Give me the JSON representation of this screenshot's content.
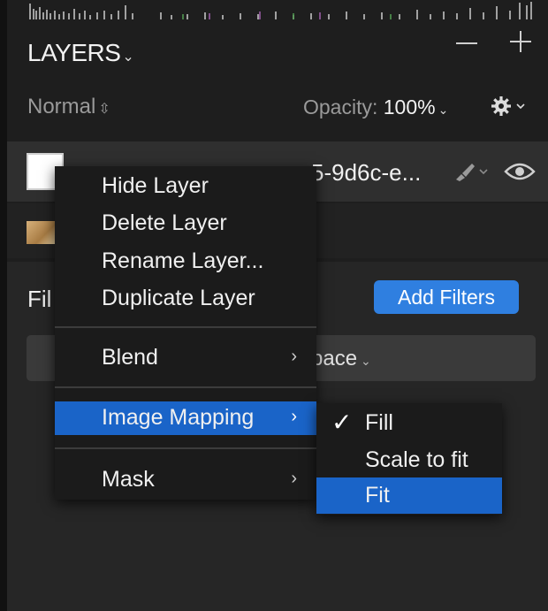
{
  "colors": {
    "accent": "#2f7fe0",
    "menu_highlight": "#1a64c8",
    "panel_bg": "#1e1e1e"
  },
  "layers_panel": {
    "title": "LAYERS",
    "title_icon": "chevron-down-icon",
    "minus_label": "−",
    "plus_label": "+",
    "blend_mode": "Normal",
    "opacity_label": "Opacity: ",
    "opacity_value": "100%",
    "settings_icon": "gear-icon"
  },
  "layers": [
    {
      "name": "5-9d6c-e...",
      "thumbnail_icon": "image-thumbnail-icon"
    },
    {
      "name": "",
      "thumbnail_icon": "photo-thumbnail-icon"
    }
  ],
  "filters": {
    "heading": "Fil",
    "add_button": "Add Filters",
    "color_space": "pace"
  },
  "context_menu": {
    "items": [
      {
        "label": "Hide Layer"
      },
      {
        "label": "Delete Layer"
      },
      {
        "label": "Rename Layer..."
      },
      {
        "label": "Duplicate Layer"
      },
      {
        "label": "Blend",
        "submenu_arrow": "›"
      },
      {
        "label": "Image Mapping",
        "submenu_arrow": "›",
        "active": true
      },
      {
        "label": "Mask",
        "submenu_arrow": "›"
      }
    ]
  },
  "image_mapping_submenu": {
    "items": [
      {
        "label": "Fill",
        "checked": true,
        "check_glyph": "✓"
      },
      {
        "label": "Scale to fit"
      },
      {
        "label": "Fit",
        "highlighted": true
      }
    ]
  }
}
